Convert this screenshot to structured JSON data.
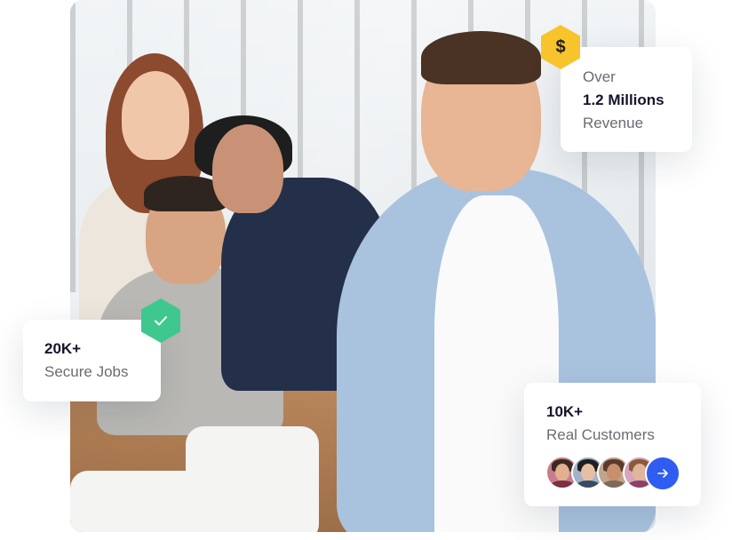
{
  "hero": {
    "image_alt": ""
  },
  "revenue_card": {
    "prefix": "Over",
    "value": "1.2 Millions",
    "label": "Revenue",
    "badge_icon": "dollar-icon",
    "badge_symbol": "$",
    "badge_color": "#f7c52b"
  },
  "jobs_card": {
    "value": "20K+",
    "label": "Secure Jobs",
    "badge_icon": "check-icon",
    "badge_color": "#3ec88e"
  },
  "customers_card": {
    "value": "10K+",
    "label": "Real Customers",
    "avatars": [
      "avatar-1",
      "avatar-2",
      "avatar-3",
      "avatar-4"
    ],
    "action_icon": "arrow-right-icon",
    "action_color": "#2f5df2"
  }
}
